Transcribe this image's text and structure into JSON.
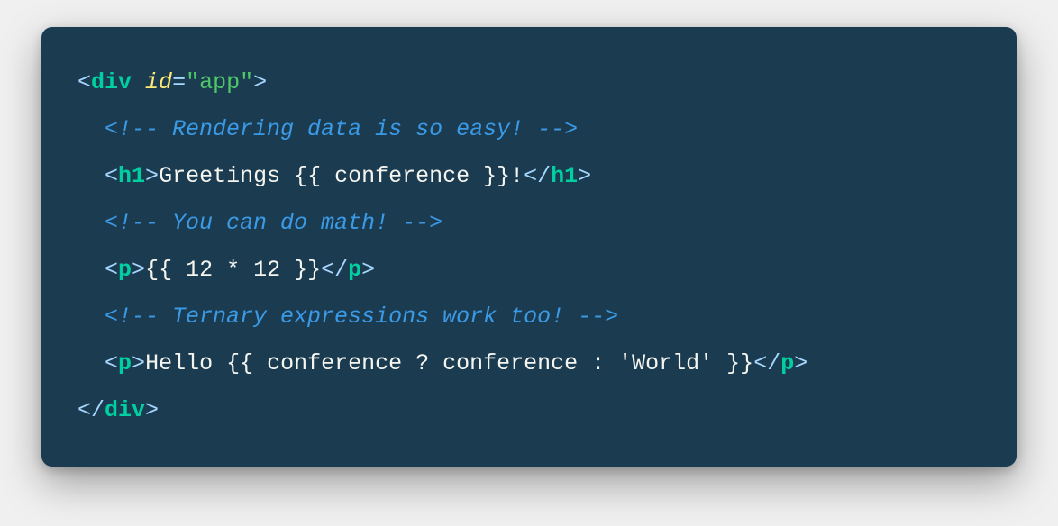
{
  "colors": {
    "background": "#1b3b50",
    "angle": "#a5d6ff",
    "tag": "#00cfa1",
    "attr": "#ffe873",
    "string": "#4ec769",
    "comment": "#3b9ae6",
    "text": "#f5f5f0"
  },
  "code": {
    "lines": [
      [
        {
          "kind": "bracket",
          "text": "<"
        },
        {
          "kind": "tagname",
          "text": "div"
        },
        {
          "kind": "text",
          "text": " "
        },
        {
          "kind": "attrname",
          "text": "id"
        },
        {
          "kind": "bracket",
          "text": "="
        },
        {
          "kind": "string",
          "text": "\"app\""
        },
        {
          "kind": "bracket",
          "text": ">"
        }
      ],
      [
        {
          "kind": "indent",
          "text": "  "
        },
        {
          "kind": "comment",
          "text": "<!-- Rendering data is so easy! -->"
        }
      ],
      [
        {
          "kind": "indent",
          "text": "  "
        },
        {
          "kind": "bracket",
          "text": "<"
        },
        {
          "kind": "tagname",
          "text": "h1"
        },
        {
          "kind": "bracket",
          "text": ">"
        },
        {
          "kind": "text",
          "text": "Greetings {{ conference }}!"
        },
        {
          "kind": "bracket",
          "text": "</"
        },
        {
          "kind": "tagname",
          "text": "h1"
        },
        {
          "kind": "bracket",
          "text": ">"
        }
      ],
      [
        {
          "kind": "indent",
          "text": "  "
        },
        {
          "kind": "comment",
          "text": "<!-- You can do math! -->"
        }
      ],
      [
        {
          "kind": "indent",
          "text": "  "
        },
        {
          "kind": "bracket",
          "text": "<"
        },
        {
          "kind": "tagname",
          "text": "p"
        },
        {
          "kind": "bracket",
          "text": ">"
        },
        {
          "kind": "text",
          "text": "{{ 12 * 12 }}"
        },
        {
          "kind": "bracket",
          "text": "</"
        },
        {
          "kind": "tagname",
          "text": "p"
        },
        {
          "kind": "bracket",
          "text": ">"
        }
      ],
      [
        {
          "kind": "indent",
          "text": "  "
        },
        {
          "kind": "comment",
          "text": "<!-- Ternary expressions work too! -->"
        }
      ],
      [
        {
          "kind": "indent",
          "text": "  "
        },
        {
          "kind": "bracket",
          "text": "<"
        },
        {
          "kind": "tagname",
          "text": "p"
        },
        {
          "kind": "bracket",
          "text": ">"
        },
        {
          "kind": "text",
          "text": "Hello {{ conference ? conference : 'World' }}"
        },
        {
          "kind": "bracket",
          "text": "</"
        },
        {
          "kind": "tagname",
          "text": "p"
        },
        {
          "kind": "bracket",
          "text": ">"
        }
      ],
      [
        {
          "kind": "bracket",
          "text": "</"
        },
        {
          "kind": "tagname",
          "text": "div"
        },
        {
          "kind": "bracket",
          "text": ">"
        }
      ]
    ]
  }
}
